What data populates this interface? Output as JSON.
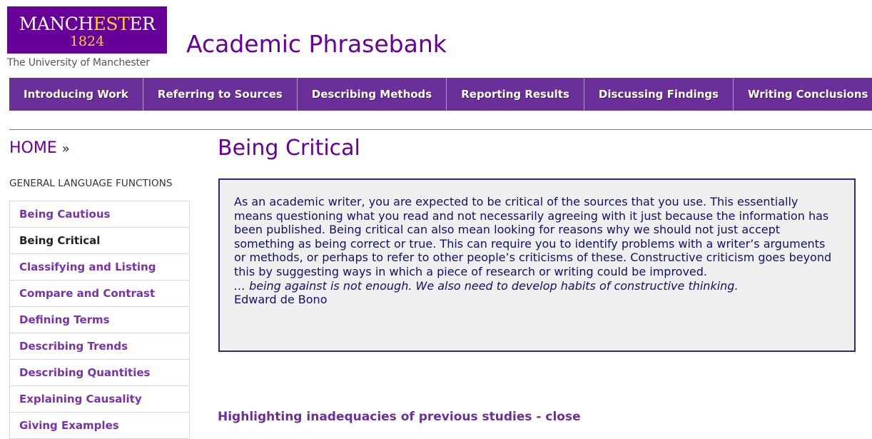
{
  "header": {
    "logo_main_pre": "MANCH",
    "logo_main_est": "EST",
    "logo_main_post": "ER",
    "logo_year": "1824",
    "logo_sub": "The University of Manchester",
    "site_title": "Academic Phrasebank"
  },
  "topnav": {
    "tabs": [
      {
        "label": "Introducing Work"
      },
      {
        "label": "Referring to Sources"
      },
      {
        "label": "Describing Methods"
      },
      {
        "label": "Reporting Results"
      },
      {
        "label": "Discussing Findings"
      },
      {
        "label": "Writing Conclusions"
      }
    ]
  },
  "sidebar": {
    "home": "HOME",
    "home_sep": "»",
    "heading": "GENERAL LANGUAGE FUNCTIONS",
    "items": [
      {
        "label": "Being Cautious"
      },
      {
        "label": "Being Critical"
      },
      {
        "label": "Classifying and Listing"
      },
      {
        "label": "Compare and Contrast"
      },
      {
        "label": "Defining Terms"
      },
      {
        "label": "Describing Trends"
      },
      {
        "label": "Describing Quantities"
      },
      {
        "label": "Explaining Causality"
      },
      {
        "label": "Giving Examples"
      }
    ]
  },
  "main": {
    "title": "Being Critical",
    "intro": "As an academic writer, you are expected to be critical of the sources that you use. This essentially means questioning what you read and not necessarily agreeing with it just because the information has been published. Being critical can also mean looking for reasons why we should not just accept something as being correct or true. This can require you to identify problems with a writer’s arguments or methods, or perhaps to refer to other people’s criticisms of these. Constructive criticism goes beyond this by suggesting ways in which a piece of research or writing could be improved.",
    "quote": "… being against is not enough. We also need to develop habits of constructive thinking.",
    "quote_author": "Edward de Bono",
    "section_heading": "Highlighting inadequacies of previous studies - close"
  }
}
